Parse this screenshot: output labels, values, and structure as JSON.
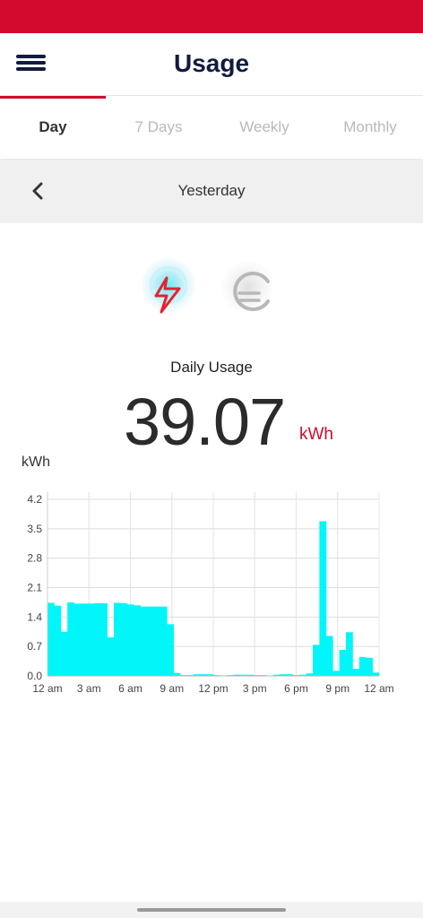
{
  "colors": {
    "brand_red": "#d20a2e",
    "title_navy": "#111b3d",
    "bar_cyan": "#00f6f8",
    "inactive_tab": "#b9b9b9"
  },
  "header": {
    "title": "Usage",
    "menu_icon": "hamburger-menu-icon"
  },
  "tabs": [
    {
      "label": "Day",
      "active": true
    },
    {
      "label": "7 Days",
      "active": false
    },
    {
      "label": "Weekly",
      "active": false
    },
    {
      "label": "Monthly",
      "active": false
    }
  ],
  "date_nav": {
    "label": "Yesterday",
    "back_icon": "chevron-left-icon"
  },
  "toggles": {
    "energy_icon": "lightning-bolt-icon",
    "cost_icon": "euro-icon",
    "selected": "energy"
  },
  "summary": {
    "label": "Daily Usage",
    "value": "39.07",
    "unit": "kWh"
  },
  "chart_data": {
    "type": "bar",
    "ylabel": "kWh",
    "ylim": [
      0,
      4.2
    ],
    "yticks": [
      "4.2",
      "3.5",
      "2.8",
      "2.1",
      "1.4",
      "0.7",
      "0.0"
    ],
    "xticks": [
      "12 am",
      "3 am",
      "6 am",
      "9 am",
      "12 pm",
      "3 pm",
      "6 pm",
      "9 pm",
      "12 am"
    ],
    "grid": true,
    "interval_minutes": 30,
    "values": [
      1.74,
      1.67,
      1.05,
      1.75,
      1.72,
      1.72,
      1.72,
      1.73,
      1.73,
      0.92,
      1.74,
      1.73,
      1.7,
      1.68,
      1.65,
      1.65,
      1.65,
      1.65,
      1.23,
      0.07,
      0.02,
      0.02,
      0.04,
      0.04,
      0.04,
      0.02,
      0.01,
      0.02,
      0.03,
      0.03,
      0.03,
      0.02,
      0.02,
      0.01,
      0.03,
      0.04,
      0.04,
      0.02,
      0.03,
      0.06,
      0.74,
      3.68,
      0.95,
      0.12,
      0.62,
      1.04,
      0.17,
      0.45,
      0.43,
      0.08
    ]
  }
}
